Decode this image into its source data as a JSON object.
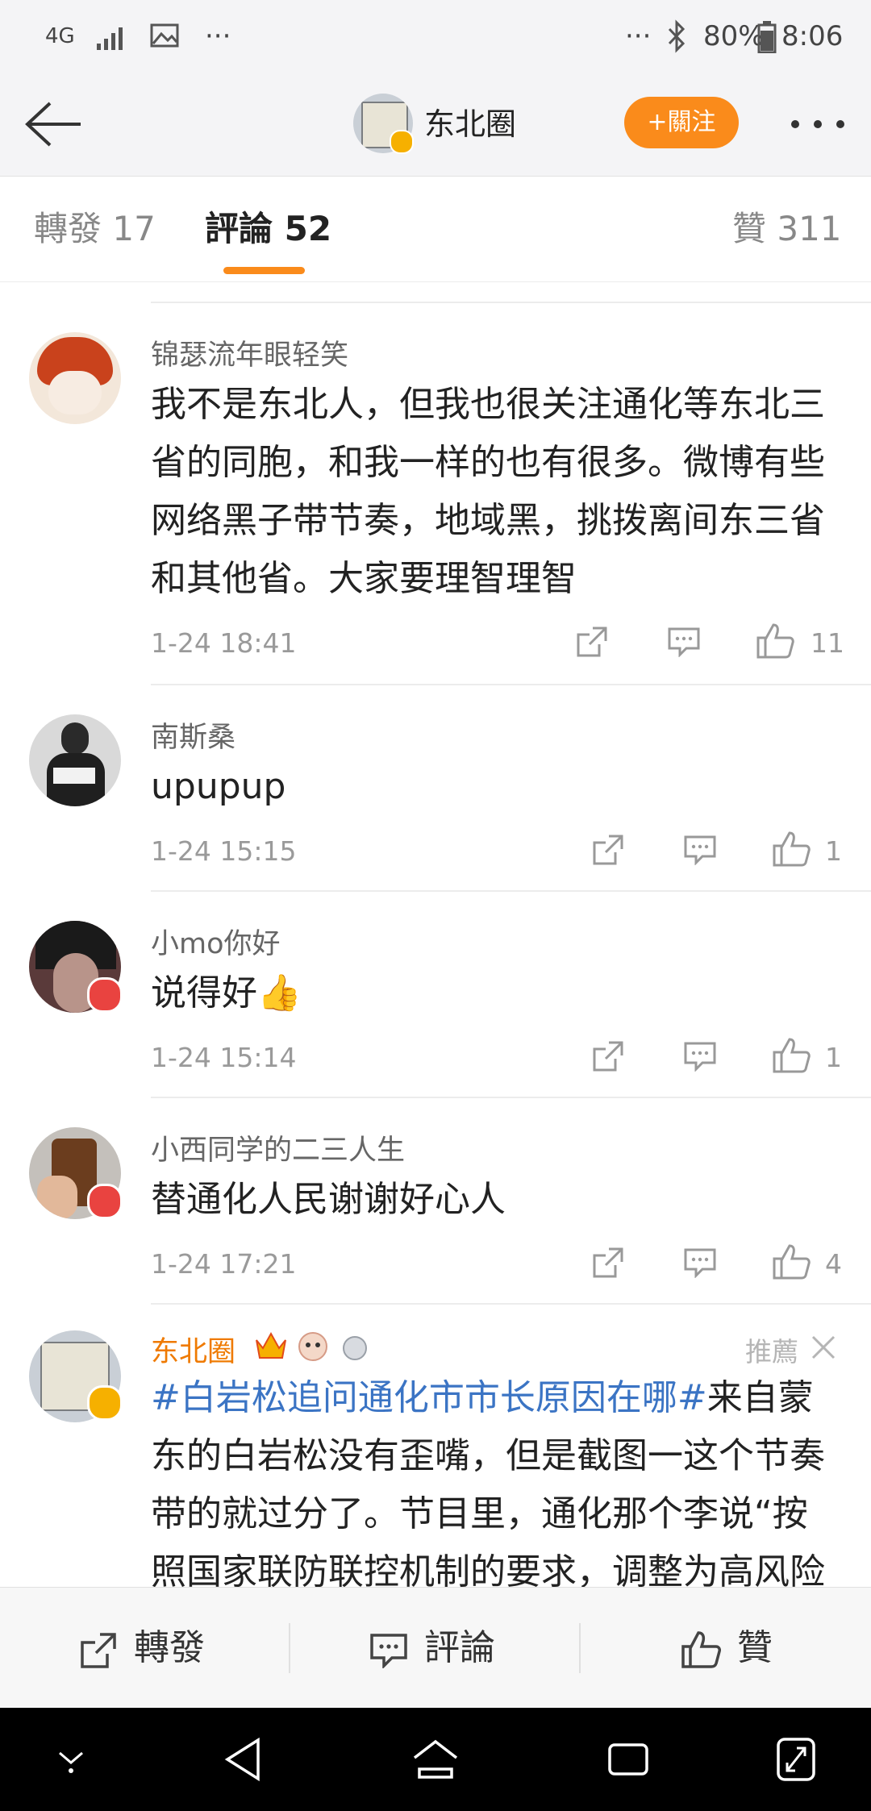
{
  "status_bar": {
    "network": "4G",
    "battery": "80%",
    "time": "8:06",
    "more_left": "···",
    "more_right": "···"
  },
  "header": {
    "title": "东北圈",
    "follow_label": "+關注"
  },
  "tabs": [
    {
      "label": "轉發 17"
    },
    {
      "label": "評論 52"
    },
    {
      "label": "贊 311"
    }
  ],
  "comments": [
    {
      "user": "锦瑟流年眼轻笑",
      "text_lines": [
        "我不是东北人，但我也很关注通化等东北三",
        "省的同胞，和我一样的也有很多。微博有些",
        "网络黑子带节奏，地域黑，挑拨离间东三省",
        "和其他省。大家要理智理智"
      ],
      "time": "1-24 18:41",
      "likes": "11"
    },
    {
      "user": "南斯桑",
      "text_lines": [
        "upupup"
      ],
      "time": "1-24 15:15",
      "likes": "1"
    },
    {
      "user": "小mo你好",
      "text_lines": [
        "说得好👍"
      ],
      "time": "1-24 15:14",
      "likes": "1"
    },
    {
      "user": "小西同学的二三人生",
      "text_lines": [
        "替通化人民谢谢好心人"
      ],
      "time": "1-24 17:21",
      "likes": "4"
    },
    {
      "user": "东北圈",
      "recommend": "推薦",
      "hashtag": "#白岩松追问通化市市长原因在哪#",
      "text_first": "来自蒙",
      "text_lines": [
        "东的白岩松没有歪嘴，但是截图一这个节奏",
        "带的就过分了。节目里，通化那个李说“按",
        "照国家联防联控机制的要求，调整为高风险"
      ]
    }
  ],
  "bottom_bar": {
    "repost": "轉發",
    "comment": "評論",
    "like": "贊"
  },
  "colors": {
    "accent": "#fa8b1b",
    "link": "#3b74c4",
    "vip_orange": "#ef7a00"
  }
}
